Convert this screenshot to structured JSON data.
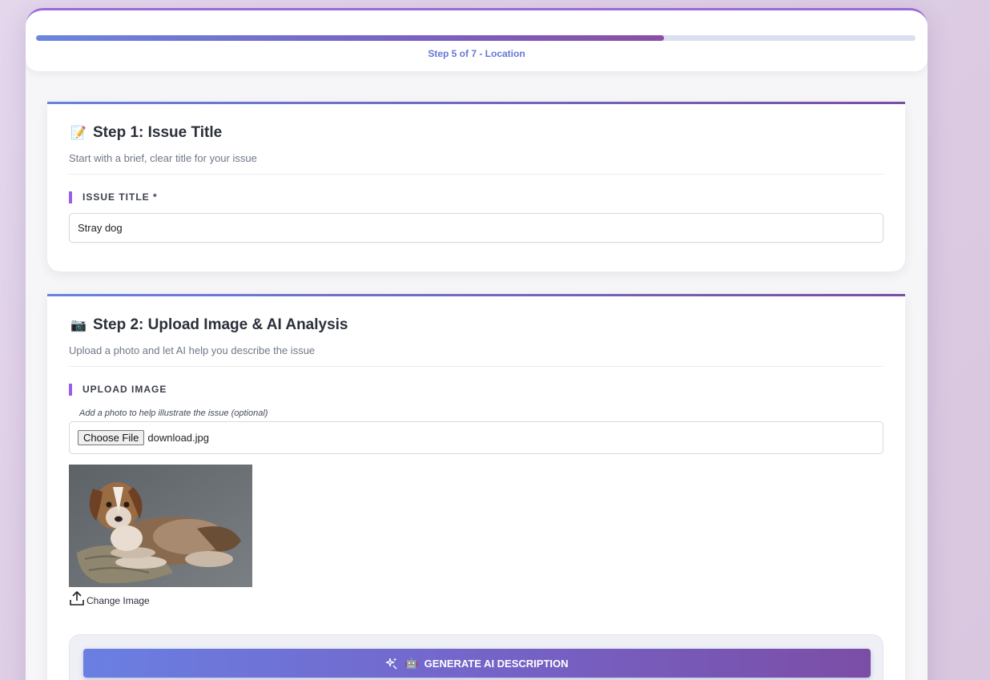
{
  "progress": {
    "label": "Step 5 of 7 - Location",
    "fraction": 0.714
  },
  "step1": {
    "emoji": "📝",
    "title": "Step 1: Issue Title",
    "subtitle": "Start with a brief, clear title for your issue",
    "field_label": "ISSUE TITLE *",
    "title_value": "Stray dog"
  },
  "step2": {
    "emoji": "📷",
    "title": "Step 2: Upload Image & AI Analysis",
    "subtitle": "Upload a photo and let AI help you describe the issue",
    "field_label": "UPLOAD IMAGE",
    "hint": "Add a photo to help illustrate the issue (optional)",
    "choose_file_label": "Choose File",
    "file_name": "download.jpg",
    "change_image_label": "Change Image",
    "ai_button_label": "GENERATE AI DESCRIPTION",
    "ai_button_emoji": "🤖"
  },
  "icons": {
    "upload": "upload-icon",
    "sparkles": "sparkles-icon"
  },
  "colors": {
    "accent_purple": "#9b5de5",
    "progress_text": "#6676d6",
    "button_start": "#6a7fe2",
    "button_end": "#7b4ea6"
  }
}
